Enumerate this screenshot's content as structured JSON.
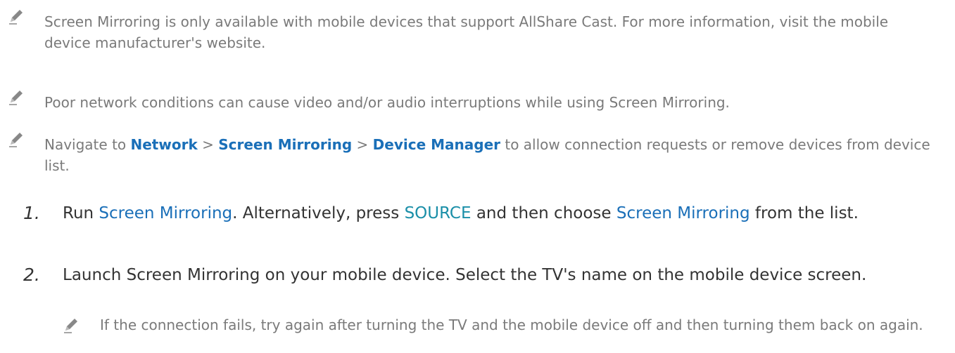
{
  "notes": [
    {
      "text": "Screen Mirroring is only available with mobile devices that support AllShare Cast. For more information, visit the mobile device manufacturer's website.",
      "icon": "pencil-icon"
    },
    {
      "text": "Poor network conditions can cause video and/or audio interruptions while using Screen Mirroring.",
      "icon": "pencil-icon"
    },
    {
      "pre": "Navigate to ",
      "link1": "Network",
      "sep1": " > ",
      "link2": "Screen Mirroring",
      "sep2": " > ",
      "link3": "Device Manager",
      "post": " to allow connection requests or remove devices from device list.",
      "icon": "pencil-icon"
    }
  ],
  "steps": [
    {
      "num": "1.",
      "pre": "Run ",
      "hl1": "Screen Mirroring",
      "mid1": ". Alternatively, press ",
      "hl2": "SOURCE",
      "mid2": " and then choose ",
      "hl3": "Screen Mirroring",
      "post": " from the list."
    },
    {
      "num": "2.",
      "text": "Launch Screen Mirroring on your mobile device. Select the TV's name on the mobile device screen."
    }
  ],
  "subnote": {
    "text": "If the connection fails, try again after turning the TV and the mobile device off and then turning them back on again.",
    "icon": "pencil-icon"
  },
  "colors": {
    "link": "#1a6fb8",
    "source": "#1a8fa8",
    "note_text": "#7a7a7a",
    "body_text": "#333333"
  }
}
